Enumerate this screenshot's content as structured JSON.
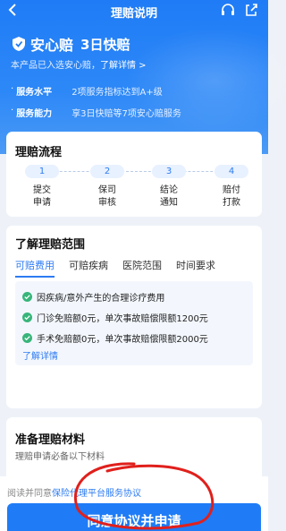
{
  "header": {
    "title": "理赔说明",
    "back_icon": "back-arrow-icon",
    "service_icon": "headset-icon",
    "share_icon": "share-icon"
  },
  "brand": {
    "name": "安心赔",
    "slogan": "3日快赔",
    "subtitle": "本产品已入选安心赔，",
    "subtitle_link": "了解详情 >"
  },
  "highlights": [
    {
      "label": "服务水平",
      "value": "2项服务指标达到A+级"
    },
    {
      "label": "服务能力",
      "value": "享3日快赔等7项安心赔服务"
    }
  ],
  "process": {
    "title": "理赔流程",
    "steps": [
      {
        "num": "1",
        "line1": "提交",
        "line2": "申请"
      },
      {
        "num": "2",
        "line1": "保司",
        "line2": "审核"
      },
      {
        "num": "3",
        "line1": "结论",
        "line2": "通知"
      },
      {
        "num": "4",
        "line1": "赔付",
        "line2": "打款"
      }
    ]
  },
  "scope": {
    "title": "了解理赔范围",
    "tabs": [
      "可赔费用",
      "可赔疾病",
      "医院范围",
      "时间要求"
    ],
    "active_tab": "可赔费用",
    "items": [
      "因疾病/意外产生的合理诊疗费用",
      "门诊免赔额0元，单次事故赔偿限额1200元",
      "手术免赔额0元，单次事故赔偿限额2000元"
    ],
    "more_link": "了解详情"
  },
  "materials": {
    "title": "准备理赔材料",
    "subtitle": "理赔申请必备以下材料"
  },
  "footer": {
    "agree_prefix": "阅读并同意",
    "agree_link": "保险代理平台服务协议",
    "submit_label": "同意协议并申请"
  },
  "colors": {
    "primary": "#1f7cf6",
    "accent_check": "#38b57a",
    "annotation": "#e0201c"
  }
}
